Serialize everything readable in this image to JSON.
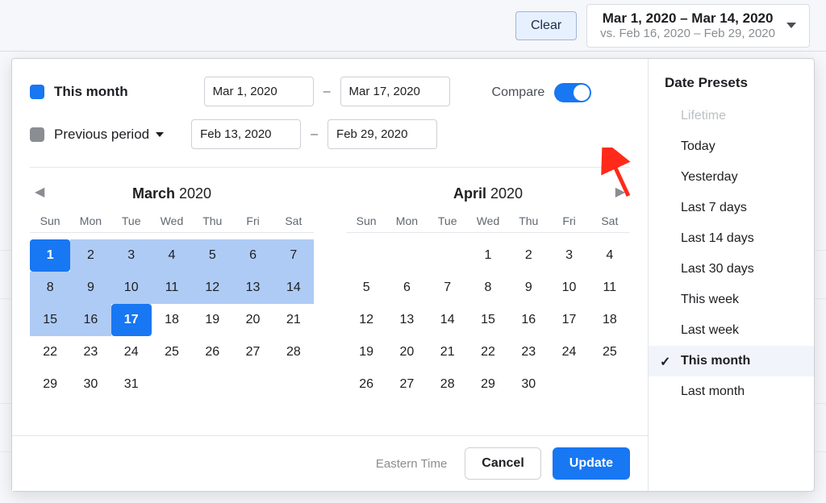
{
  "topbar": {
    "clear_label": "Clear",
    "range_primary": "Mar 1, 2020 – Mar 14, 2020",
    "range_secondary": "vs. Feb 16, 2020 – Feb 29, 2020"
  },
  "ranges": {
    "this_month": {
      "label": "This month",
      "start": "Mar 1, 2020",
      "end": "Mar 17, 2020"
    },
    "previous": {
      "label": "Previous period",
      "start": "Feb 13, 2020",
      "end": "Feb 29, 2020"
    }
  },
  "compare": {
    "label": "Compare",
    "on": true
  },
  "calendars": {
    "dow": [
      "Sun",
      "Mon",
      "Tue",
      "Wed",
      "Thu",
      "Fri",
      "Sat"
    ],
    "left": {
      "month": "March",
      "year": "2020",
      "lead_blanks": 0,
      "days": 31,
      "range_start": 1,
      "range_end": 17
    },
    "right": {
      "month": "April",
      "year": "2020",
      "lead_blanks": 3,
      "days": 30,
      "range_start": 0,
      "range_end": 0
    }
  },
  "footer": {
    "timezone": "Eastern Time",
    "cancel": "Cancel",
    "update": "Update"
  },
  "presets": {
    "title": "Date Presets",
    "items": [
      {
        "label": "Lifetime",
        "disabled": true,
        "selected": false
      },
      {
        "label": "Today",
        "disabled": false,
        "selected": false
      },
      {
        "label": "Yesterday",
        "disabled": false,
        "selected": false
      },
      {
        "label": "Last 7 days",
        "disabled": false,
        "selected": false
      },
      {
        "label": "Last 14 days",
        "disabled": false,
        "selected": false
      },
      {
        "label": "Last 30 days",
        "disabled": false,
        "selected": false
      },
      {
        "label": "This week",
        "disabled": false,
        "selected": false
      },
      {
        "label": "Last week",
        "disabled": false,
        "selected": false
      },
      {
        "label": "This month",
        "disabled": false,
        "selected": true
      },
      {
        "label": "Last month",
        "disabled": false,
        "selected": false
      }
    ]
  }
}
